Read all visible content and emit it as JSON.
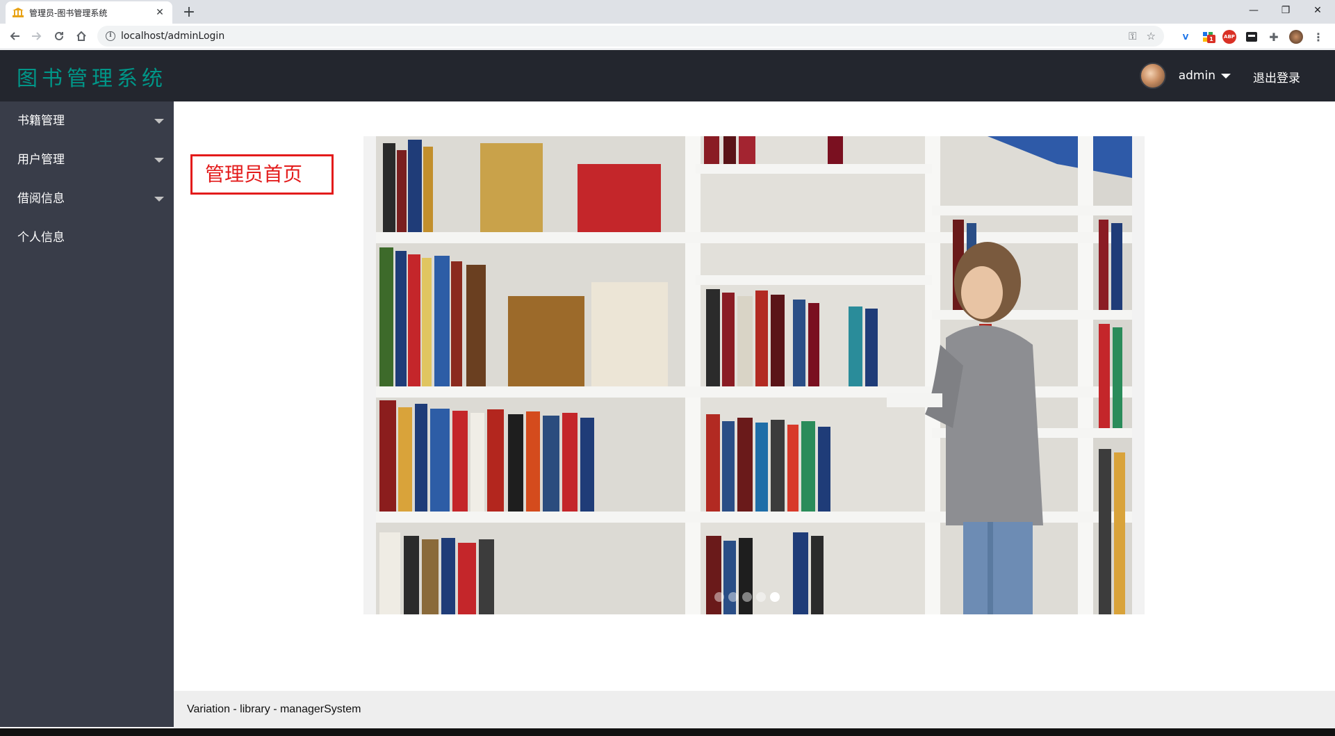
{
  "browser": {
    "tab_title": "管理员-图书管理系统",
    "tab_close": "✕",
    "new_tab": "+",
    "url": "localhost/adminLogin",
    "window_controls": {
      "minimize": "—",
      "restore": "❐",
      "close": "✕"
    },
    "extensions": [
      "V",
      "ABP"
    ],
    "extension_badge": "1"
  },
  "header": {
    "logo": "图书管理系统",
    "username": "admin",
    "logout": "退出登录"
  },
  "sidebar": {
    "items": [
      {
        "label": "书籍管理",
        "has_submenu": true
      },
      {
        "label": "用户管理",
        "has_submenu": true
      },
      {
        "label": "借阅信息",
        "has_submenu": true
      },
      {
        "label": "个人信息",
        "has_submenu": false
      }
    ]
  },
  "main": {
    "home_label": "管理员首页",
    "carousel": {
      "slide_count": 5,
      "active_index": 4
    }
  },
  "footer": {
    "text": "Variation - library - managerSystem"
  },
  "colors": {
    "header_bg": "#23262e",
    "sidebar_bg": "#393d49",
    "logo": "#009688",
    "home_label": "#e31b1b"
  }
}
